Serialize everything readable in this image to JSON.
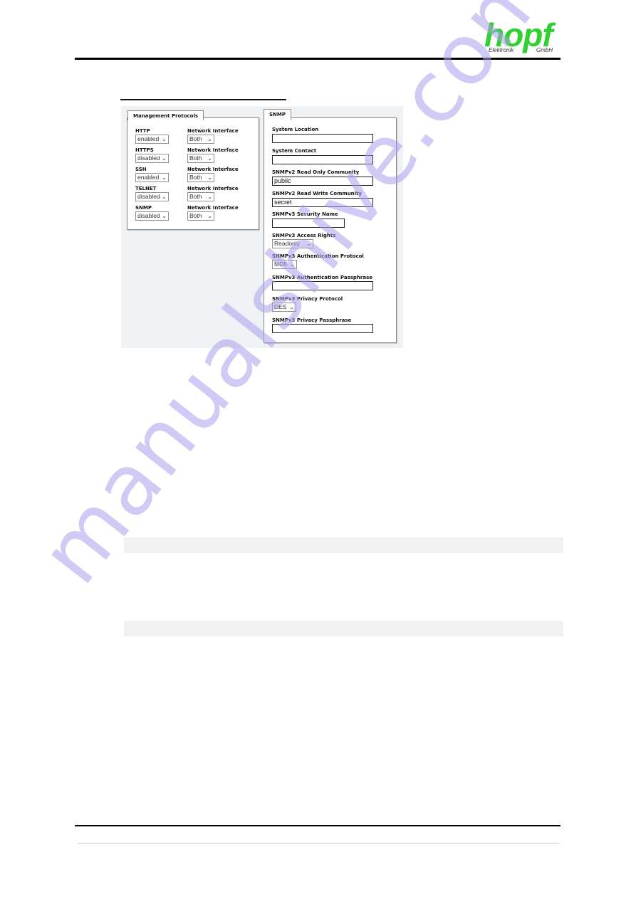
{
  "header": {
    "logo_word": "hopf",
    "logo_sub_left": "Elektronik",
    "logo_sub_right": "GmbH",
    "logo_color": "#2ed12e"
  },
  "management_protocols": {
    "tab_label": "Management Protocols",
    "rows": [
      {
        "protocol": "HTTP",
        "value": "enabled",
        "iface_label": "Network Interface",
        "iface_value": "Both"
      },
      {
        "protocol": "HTTPS",
        "value": "disabled",
        "iface_label": "Network Interface",
        "iface_value": "Both"
      },
      {
        "protocol": "SSH",
        "value": "enabled",
        "iface_label": "Network Interface",
        "iface_value": "Both"
      },
      {
        "protocol": "TELNET",
        "value": "disabled",
        "iface_label": "Network Interface",
        "iface_value": "Both"
      },
      {
        "protocol": "SNMP",
        "value": "disabled",
        "iface_label": "Network Interface",
        "iface_value": "Both"
      }
    ]
  },
  "snmp": {
    "tab_label": "SNMP",
    "system_location": {
      "label": "System Location",
      "value": ""
    },
    "system_contact": {
      "label": "System Contact",
      "value": ""
    },
    "v2_ro_community": {
      "label": "SNMPv2 Read Only Community",
      "value": "public"
    },
    "v2_rw_community": {
      "label": "SNMPv2 Read Write Community",
      "value": "secret"
    },
    "v3_security_name": {
      "label": "SNMPv3 Security Name",
      "value": ""
    },
    "v3_access_rights": {
      "label": "SNMPv3 Access Rights",
      "value": "Readonly"
    },
    "v3_auth_protocol": {
      "label": "SNMPv3 Authentication Protocol",
      "value": "MD5"
    },
    "v3_auth_passphrase": {
      "label": "SNMPv3 Authentication Passphrase",
      "value": ""
    },
    "v3_priv_protocol": {
      "label": "SNMPv3 Privacy Protocol",
      "value": "DES"
    },
    "v3_priv_passphrase": {
      "label": "SNMPv3 Privacy Passphrase",
      "value": ""
    }
  },
  "icons": {
    "chevron": "⌄"
  },
  "watermark": "manualshive.com"
}
